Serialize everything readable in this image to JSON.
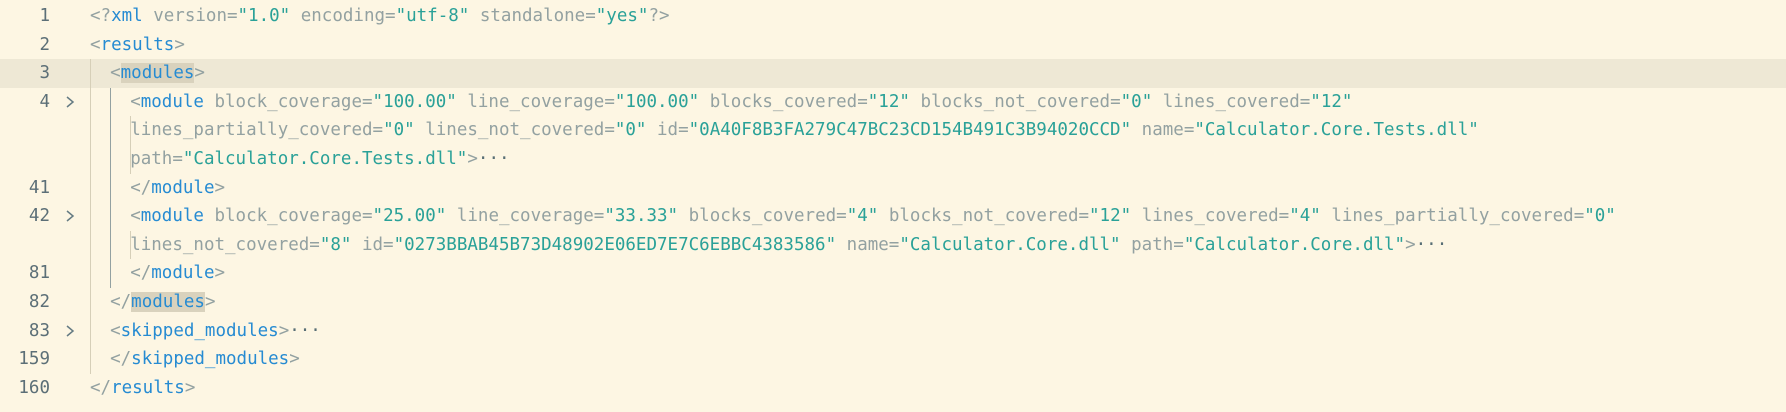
{
  "editor": {
    "lines": [
      {
        "num": "1",
        "fold": false,
        "segments": [
          {
            "c": "p",
            "t": "<?"
          },
          {
            "c": "t",
            "t": "xml"
          },
          {
            "c": "a",
            "t": " version="
          },
          {
            "c": "s",
            "t": "\"1.0\""
          },
          {
            "c": "a",
            "t": " encoding="
          },
          {
            "c": "s",
            "t": "\"utf-8\""
          },
          {
            "c": "a",
            "t": " standalone="
          },
          {
            "c": "s",
            "t": "\"yes\""
          },
          {
            "c": "p",
            "t": "?>"
          }
        ]
      },
      {
        "num": "2",
        "fold": false,
        "segments": [
          {
            "c": "p",
            "t": "<"
          },
          {
            "c": "t",
            "t": "results"
          },
          {
            "c": "p",
            "t": ">"
          }
        ]
      },
      {
        "num": "3",
        "fold": false,
        "active": true,
        "segments": [
          {
            "c": "p",
            "t": "<"
          },
          {
            "c": "t hl",
            "t": "modules"
          },
          {
            "c": "p",
            "t": ">"
          }
        ]
      },
      {
        "num": "4",
        "fold": true,
        "segments": [
          {
            "c": "p",
            "t": "<"
          },
          {
            "c": "t",
            "t": "module"
          },
          {
            "c": "a",
            "t": " block_coverage="
          },
          {
            "c": "s",
            "t": "\"100.00\""
          },
          {
            "c": "a",
            "t": " line_coverage="
          },
          {
            "c": "s",
            "t": "\"100.00\""
          },
          {
            "c": "a",
            "t": " blocks_covered="
          },
          {
            "c": "s",
            "t": "\"12\""
          },
          {
            "c": "a",
            "t": " blocks_not_covered="
          },
          {
            "c": "s",
            "t": "\"0\""
          },
          {
            "c": "a",
            "t": " lines_covered="
          },
          {
            "c": "s",
            "t": "\"12\""
          }
        ]
      },
      {
        "num": "",
        "fold": false,
        "segments": [
          {
            "c": "a",
            "t": "lines_partially_covered="
          },
          {
            "c": "s",
            "t": "\"0\""
          },
          {
            "c": "a",
            "t": " lines_not_covered="
          },
          {
            "c": "s",
            "t": "\"0\""
          },
          {
            "c": "a",
            "t": " id="
          },
          {
            "c": "s",
            "t": "\"0A40F8B3FA279C47BC23CD154B491C3B94020CCD\""
          },
          {
            "c": "a",
            "t": " name="
          },
          {
            "c": "s",
            "t": "\"Calculator.Core.Tests.dll\""
          }
        ]
      },
      {
        "num": "",
        "fold": false,
        "segments": [
          {
            "c": "a",
            "t": "path="
          },
          {
            "c": "s",
            "t": "\"Calculator.Core.Tests.dll\""
          },
          {
            "c": "p",
            "t": ">"
          },
          {
            "c": "ell",
            "t": "···"
          }
        ]
      },
      {
        "num": "41",
        "fold": false,
        "segments": [
          {
            "c": "p",
            "t": "</"
          },
          {
            "c": "t",
            "t": "module"
          },
          {
            "c": "p",
            "t": ">"
          }
        ]
      },
      {
        "num": "42",
        "fold": true,
        "segments": [
          {
            "c": "p",
            "t": "<"
          },
          {
            "c": "t",
            "t": "module"
          },
          {
            "c": "a",
            "t": " block_coverage="
          },
          {
            "c": "s",
            "t": "\"25.00\""
          },
          {
            "c": "a",
            "t": " line_coverage="
          },
          {
            "c": "s",
            "t": "\"33.33\""
          },
          {
            "c": "a",
            "t": " blocks_covered="
          },
          {
            "c": "s",
            "t": "\"4\""
          },
          {
            "c": "a",
            "t": " blocks_not_covered="
          },
          {
            "c": "s",
            "t": "\"12\""
          },
          {
            "c": "a",
            "t": " lines_covered="
          },
          {
            "c": "s",
            "t": "\"4\""
          },
          {
            "c": "a",
            "t": " lines_partially_covered="
          },
          {
            "c": "s",
            "t": "\"0\""
          }
        ]
      },
      {
        "num": "",
        "fold": false,
        "segments": [
          {
            "c": "a",
            "t": "lines_not_covered="
          },
          {
            "c": "s",
            "t": "\"8\""
          },
          {
            "c": "a",
            "t": " id="
          },
          {
            "c": "s",
            "t": "\"0273BBAB45B73D48902E06ED7E7C6EBBC4383586\""
          },
          {
            "c": "a",
            "t": " name="
          },
          {
            "c": "s",
            "t": "\"Calculator.Core.dll\""
          },
          {
            "c": "a",
            "t": " path="
          },
          {
            "c": "s",
            "t": "\"Calculator.Core.dll\""
          },
          {
            "c": "p",
            "t": ">"
          },
          {
            "c": "ell",
            "t": "···"
          }
        ]
      },
      {
        "num": "81",
        "fold": false,
        "segments": [
          {
            "c": "p",
            "t": "</"
          },
          {
            "c": "t",
            "t": "module"
          },
          {
            "c": "p",
            "t": ">"
          }
        ]
      },
      {
        "num": "82",
        "fold": false,
        "segments": [
          {
            "c": "p",
            "t": "</"
          },
          {
            "c": "t hl",
            "t": "modules"
          },
          {
            "c": "p",
            "t": ">"
          }
        ]
      },
      {
        "num": "83",
        "fold": true,
        "segments": [
          {
            "c": "p",
            "t": "<"
          },
          {
            "c": "t",
            "t": "skipped_modules"
          },
          {
            "c": "p",
            "t": ">"
          },
          {
            "c": "ell",
            "t": "···"
          }
        ]
      },
      {
        "num": "159",
        "fold": false,
        "segments": [
          {
            "c": "p",
            "t": "</"
          },
          {
            "c": "t",
            "t": "skipped_modules"
          },
          {
            "c": "p",
            "t": ">"
          }
        ]
      },
      {
        "num": "160",
        "fold": false,
        "segments": [
          {
            "c": "p",
            "t": "</"
          },
          {
            "c": "t",
            "t": "results"
          },
          {
            "c": "p",
            "t": ">"
          }
        ]
      }
    ]
  },
  "colors": {
    "background": "#fdf6e3",
    "active_line": "#eee8d5",
    "tag": "#268bd2",
    "attribute": "#93a1a1",
    "string": "#2aa198",
    "line_number": "#5c6f77"
  },
  "icons": {
    "fold": "chevron-right-icon"
  }
}
